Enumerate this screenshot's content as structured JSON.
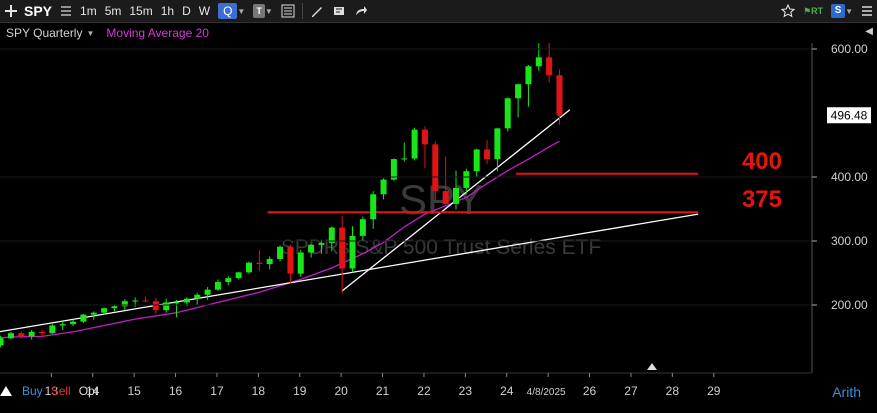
{
  "toolbar": {
    "symbol": "SPY",
    "intervals": [
      "1m",
      "5m",
      "15m",
      "1h",
      "D",
      "W",
      "Q"
    ],
    "active_interval": "Q",
    "rt_label": "RT",
    "s_label": "S"
  },
  "header": {
    "symbol_label": "SPY Quarterly",
    "indicator_label": "Moving Average 20"
  },
  "watermark": {
    "symbol": "SPY",
    "name": "SPDRs S&P 500 Trust Series ETF"
  },
  "bottom": {
    "buy": "Buy",
    "sell": "Sell",
    "opt": "Opt",
    "scale": "Arith"
  },
  "colors": {
    "up": "#19e619",
    "down": "#e01414",
    "ma": "#c21fc2",
    "trend": "#ffffff",
    "level": "#e51414",
    "price_label_bg": "#ffffff"
  },
  "chart_data": {
    "type": "candlestick",
    "x_axis_labels": [
      "13",
      "14",
      "15",
      "16",
      "17",
      "18",
      "19",
      "20",
      "21",
      "22",
      "23",
      "24",
      "4/8/2025",
      "26",
      "27",
      "28",
      "29"
    ],
    "y_ticks": [
      "600.00",
      "400.00",
      "300.00",
      "200.00"
    ],
    "ylim": [
      140,
      620
    ],
    "current_price_label": "496.48",
    "levels": [
      {
        "label": "400",
        "value": 405
      },
      {
        "label": "375",
        "value": 345
      }
    ],
    "moving_average_period": 20,
    "candles": [
      [
        2010.0,
        150,
        152,
        138,
        144
      ],
      [
        2010.25,
        144,
        153,
        140,
        149
      ],
      [
        2010.5,
        149,
        151,
        136,
        141
      ],
      [
        2010.75,
        141,
        155,
        140,
        152
      ],
      [
        2011.0,
        152,
        158,
        147,
        154
      ],
      [
        2011.25,
        154,
        157,
        148,
        150
      ],
      [
        2011.5,
        150,
        153,
        134,
        137
      ],
      [
        2011.75,
        137,
        152,
        134,
        148
      ],
      [
        2012.0,
        148,
        158,
        147,
        156
      ],
      [
        2012.25,
        156,
        159,
        147,
        151
      ],
      [
        2012.5,
        151,
        161,
        146,
        158
      ],
      [
        2012.75,
        158,
        161,
        150,
        156
      ],
      [
        2013.0,
        156,
        170,
        155,
        168
      ],
      [
        2013.25,
        168,
        175,
        161,
        170
      ],
      [
        2013.5,
        170,
        177,
        167,
        174
      ],
      [
        2013.75,
        174,
        186,
        172,
        185
      ],
      [
        2014.0,
        185,
        190,
        177,
        188
      ],
      [
        2014.25,
        188,
        196,
        185,
        195
      ],
      [
        2014.5,
        195,
        201,
        190,
        198
      ],
      [
        2014.75,
        198,
        209,
        192,
        206
      ],
      [
        2015.0,
        206,
        212,
        197,
        207
      ],
      [
        2015.25,
        207,
        213,
        204,
        206
      ],
      [
        2015.5,
        206,
        211,
        186,
        192
      ],
      [
        2015.75,
        192,
        210,
        188,
        204
      ],
      [
        2016.0,
        204,
        208,
        181,
        204
      ],
      [
        2016.25,
        204,
        212,
        198,
        210
      ],
      [
        2016.5,
        210,
        219,
        201,
        216
      ],
      [
        2016.75,
        216,
        228,
        208,
        224
      ],
      [
        2017.0,
        224,
        240,
        222,
        236
      ],
      [
        2017.25,
        236,
        245,
        231,
        242
      ],
      [
        2017.5,
        242,
        252,
        240,
        251
      ],
      [
        2017.75,
        251,
        268,
        249,
        266
      ],
      [
        2018.0,
        266,
        286,
        253,
        264
      ],
      [
        2018.25,
        264,
        276,
        256,
        272
      ],
      [
        2018.5,
        272,
        293,
        268,
        291
      ],
      [
        2018.75,
        291,
        294,
        233,
        249
      ],
      [
        2019.0,
        249,
        286,
        244,
        282
      ],
      [
        2019.25,
        282,
        295,
        274,
        294
      ],
      [
        2019.5,
        294,
        302,
        280,
        297
      ],
      [
        2019.75,
        297,
        323,
        284,
        321
      ],
      [
        2020.0,
        321,
        339,
        218,
        257
      ],
      [
        2020.25,
        257,
        323,
        251,
        308
      ],
      [
        2020.5,
        308,
        338,
        300,
        334
      ],
      [
        2020.75,
        334,
        378,
        319,
        373
      ],
      [
        2021.0,
        373,
        398,
        365,
        396
      ],
      [
        2021.25,
        396,
        429,
        394,
        428
      ],
      [
        2021.5,
        428,
        454,
        424,
        429
      ],
      [
        2021.75,
        429,
        477,
        426,
        474
      ],
      [
        2022.0,
        474,
        479,
        414,
        451
      ],
      [
        2022.25,
        451,
        456,
        363,
        378
      ],
      [
        2022.5,
        378,
        432,
        357,
        358
      ],
      [
        2022.75,
        358,
        410,
        349,
        383
      ],
      [
        2023.0,
        383,
        413,
        373,
        409
      ],
      [
        2023.25,
        409,
        444,
        401,
        443
      ],
      [
        2023.5,
        443,
        458,
        420,
        428
      ],
      [
        2023.75,
        428,
        477,
        409,
        476
      ],
      [
        2024.0,
        476,
        524,
        471,
        523
      ],
      [
        2024.25,
        523,
        546,
        493,
        545
      ],
      [
        2024.5,
        545,
        575,
        510,
        573
      ],
      [
        2024.75,
        573,
        609,
        566,
        587
      ],
      [
        2025.0,
        587,
        613,
        548,
        559
      ],
      [
        2025.25,
        559,
        568,
        482,
        496
      ]
    ],
    "moving_average": [
      [
        2010.0,
        148
      ],
      [
        2011.0,
        145
      ],
      [
        2012.0,
        150
      ],
      [
        2012.75,
        151
      ],
      [
        2013.5,
        158
      ],
      [
        2014.25,
        168
      ],
      [
        2015.0,
        178
      ],
      [
        2016.0,
        188
      ],
      [
        2017.0,
        204
      ],
      [
        2018.0,
        220
      ],
      [
        2019.0,
        240
      ],
      [
        2019.75,
        258
      ],
      [
        2020.5,
        280
      ],
      [
        2021.0,
        298
      ],
      [
        2021.5,
        322
      ],
      [
        2022.0,
        342
      ],
      [
        2022.5,
        355
      ],
      [
        2023.0,
        368
      ],
      [
        2023.5,
        390
      ],
      [
        2024.0,
        410
      ],
      [
        2024.5,
        428
      ],
      [
        2025.0,
        447
      ],
      [
        2025.25,
        456
      ]
    ],
    "trendlines": [
      {
        "from": [
          2010.05,
          140
        ],
        "to": [
          2028.6,
          342
        ]
      },
      {
        "from": [
          2020.0,
          222
        ],
        "to": [
          2025.5,
          505
        ]
      }
    ]
  }
}
